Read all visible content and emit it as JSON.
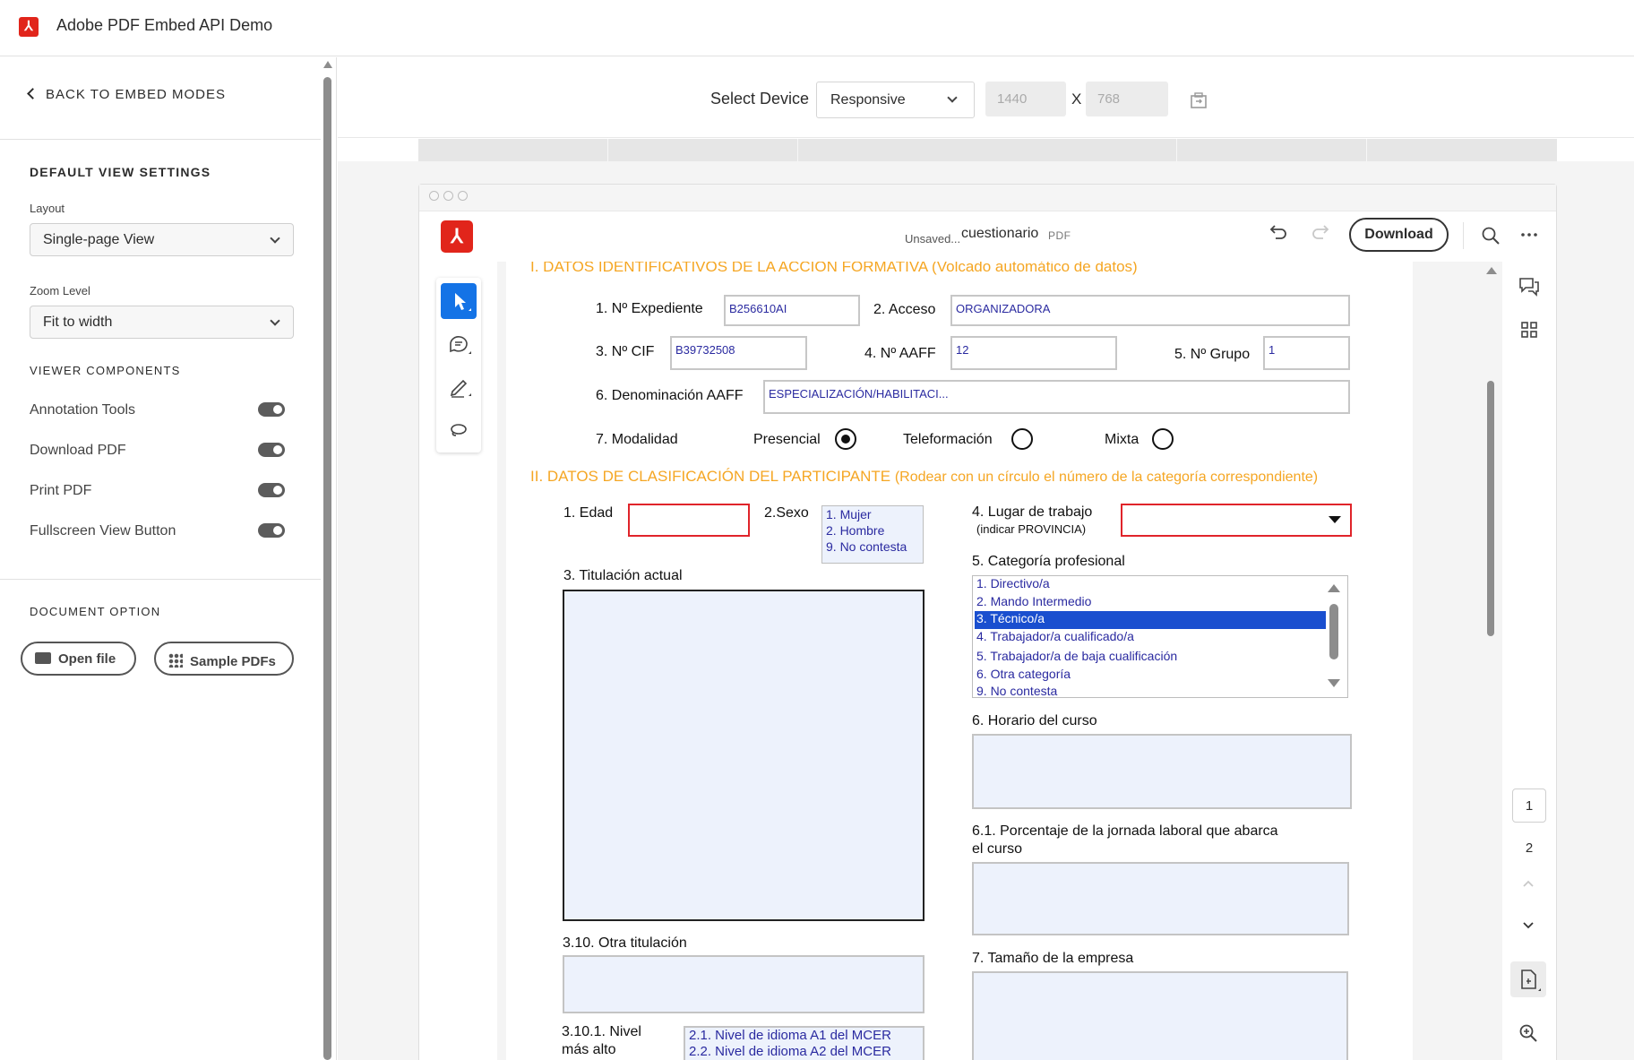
{
  "app": {
    "title": "Adobe PDF Embed API Demo",
    "logo_icon": "adobe-pdf-icon"
  },
  "sidebar": {
    "back_label": "BACK TO EMBED MODES",
    "default_view_title": "DEFAULT VIEW SETTINGS",
    "layout_label": "Layout",
    "layout_value": "Single-page View",
    "zoom_label": "Zoom Level",
    "zoom_value": "Fit to width",
    "viewer_components_title": "VIEWER COMPONENTS",
    "toggles": [
      {
        "label": "Annotation Tools",
        "on": true
      },
      {
        "label": "Download PDF",
        "on": true
      },
      {
        "label": "Print PDF",
        "on": true
      },
      {
        "label": "Fullscreen View Button",
        "on": true
      }
    ],
    "document_option_title": "DOCUMENT OPTION",
    "open_file_label": "Open file",
    "sample_pdfs_label": "Sample PDFs"
  },
  "device_bar": {
    "label": "Select Device",
    "device_value": "Responsive",
    "width_placeholder": "1440",
    "height_placeholder": "768",
    "x_label": "X"
  },
  "viewer": {
    "unsaved_label": "Unsaved...",
    "doc_name": "cuestionario",
    "doc_type": "PDF",
    "download_label": "Download",
    "pages": [
      "1",
      "2"
    ],
    "current_page": "1"
  },
  "form": {
    "section1_title": "I. DATOS IDENTIFICATIVOS DE LA ACCIÓN FORMATIVA (Volcado automático de datos)",
    "expediente_label": "1.  Nº Expediente",
    "expediente_value": "B256610AI",
    "acceso_label": "2. Acceso",
    "acceso_value": "ORGANIZADORA",
    "cif_label": "3. Nº CIF",
    "cif_value": "B39732508",
    "aaff_label": "4. Nº AAFF",
    "aaff_value": "12",
    "grupo_label": "5. Nº Grupo",
    "grupo_value": "1",
    "denominacion_label": "6. Denominación AAFF",
    "denominacion_value": "ESPECIALIZACIÓN/HABILITACI...",
    "modalidad_label": "7. Modalidad",
    "modalidad_options": [
      "Presencial",
      "Teleformación",
      "Mixta"
    ],
    "modalidad_selected": "Presencial",
    "section2_title_main": "II. DATOS DE CLASIFICACIÓN DEL PARTICIPANTE",
    "section2_title_note": "(Rodear con un círculo el número de la categoría correspondiente)",
    "edad_label": "1.  Edad",
    "sexo_label": "2.Sexo",
    "sexo_options": [
      "1. Mujer",
      "2. Hombre",
      "9. No contesta"
    ],
    "lugar_label": "4.  Lugar de trabajo",
    "lugar_sublabel": "(indicar PROVINCIA)",
    "titulacion_label": "3. Titulación actual",
    "categoria_label": "5. Categoría profesional",
    "categoria_options": [
      "1. Directivo/a",
      "2. Mando Intermedio",
      "3. Técnico/a",
      "4. Trabajador/a cualificado/a",
      "5. Trabajador/a de baja cualificación",
      "6. Otra categoría",
      "9. No contesta"
    ],
    "categoria_selected": "3. Técnico/a",
    "horario_label": "6. Horario del curso",
    "porcentaje_label_1": "6.1. Porcentaje de la jornada laboral que abarca",
    "porcentaje_label_2": "el curso",
    "otra_titulacion_label": "3.10. Otra titulación",
    "tamano_label": "7. Tamaño de la empresa",
    "nivel_label_1": "3.10.1. Nivel",
    "nivel_label_2": "más alto",
    "nivel_options": [
      "2.1. Nivel de idioma A1 del MCER",
      "2.2. Nivel de idioma A2 del MCER"
    ]
  },
  "colors": {
    "accent": "#1473e6",
    "section_orange": "#f5a623",
    "field_blue_text": "#2a2aa0",
    "adobe_red": "#e1251b"
  }
}
